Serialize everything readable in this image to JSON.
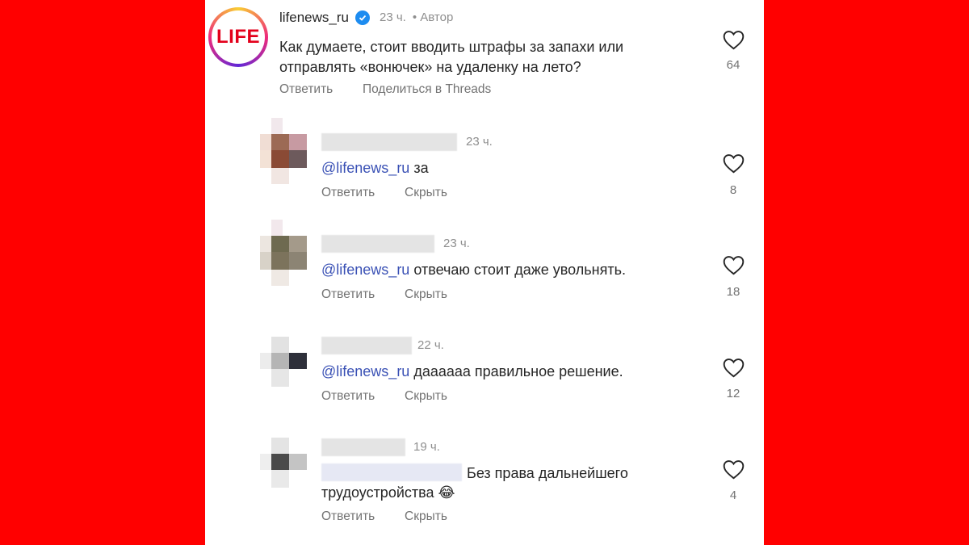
{
  "colors": {
    "background": "#ff0000",
    "panel": "#ffffff",
    "mention": "#3a51b5",
    "text": "#262626",
    "muted": "#8e8e8e",
    "verified": "#1d8cf0"
  },
  "post": {
    "username": "lifenews_ru",
    "time": "23 ч.",
    "author_badge": "• Автор",
    "logo_text": "LIFE",
    "text_line1": "Как думаете, стоит вводить штрафы за запахи или",
    "text_line2": "отправлять «вонючек» на удаленку на лето?",
    "reply_label": "Ответить",
    "share_label": "Поделиться в Threads",
    "likes": "64",
    "icons": {
      "like": "heart-icon",
      "verified": "verified-badge-icon"
    }
  },
  "replies": [
    {
      "time": "23 ч.",
      "mention": "@lifenews_ru",
      "text": "за",
      "reply_label": "Ответить",
      "hide_label": "Скрыть",
      "likes": "8"
    },
    {
      "time": "23 ч.",
      "mention": "@lifenews_ru",
      "text": "отвечаю стоит  даже увольнять.",
      "reply_label": "Ответить",
      "hide_label": "Скрыть",
      "likes": "18"
    },
    {
      "time": "22 ч.",
      "mention": "@lifenews_ru",
      "text": "даааааа правильное решение.",
      "reply_label": "Ответить",
      "hide_label": "Скрыть",
      "likes": "12"
    },
    {
      "time": "19 ч.",
      "text_line1": "Без права дальнейшего",
      "text_line2": "трудоустройства 😂",
      "reply_label": "Ответить",
      "hide_label": "Скрыть",
      "likes": "4"
    }
  ]
}
